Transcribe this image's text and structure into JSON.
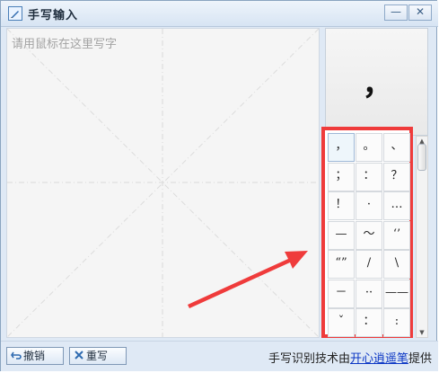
{
  "window": {
    "title": "手写输入",
    "minimize_glyph": "—",
    "close_glyph": "✕"
  },
  "writing_area": {
    "placeholder": "请用鼠标在这里写字"
  },
  "preview": {
    "char": "，"
  },
  "candidates": [
    "，",
    "。",
    "、",
    "；",
    "：",
    "？",
    "！",
    "·",
    "…",
    "—",
    "～",
    "‘’",
    "“”",
    "/",
    "\\",
    "－",
    "··",
    "——",
    "ˇ",
    "：",
    ":"
  ],
  "toolbar": {
    "undo_label": "撤销",
    "rewrite_label": "重写"
  },
  "credit": {
    "prefix": "手写识别技术由",
    "link": "开心逍遥笔",
    "suffix": "提供"
  },
  "colors": {
    "highlight": "#ef3b3b",
    "link": "#0b36c4"
  }
}
